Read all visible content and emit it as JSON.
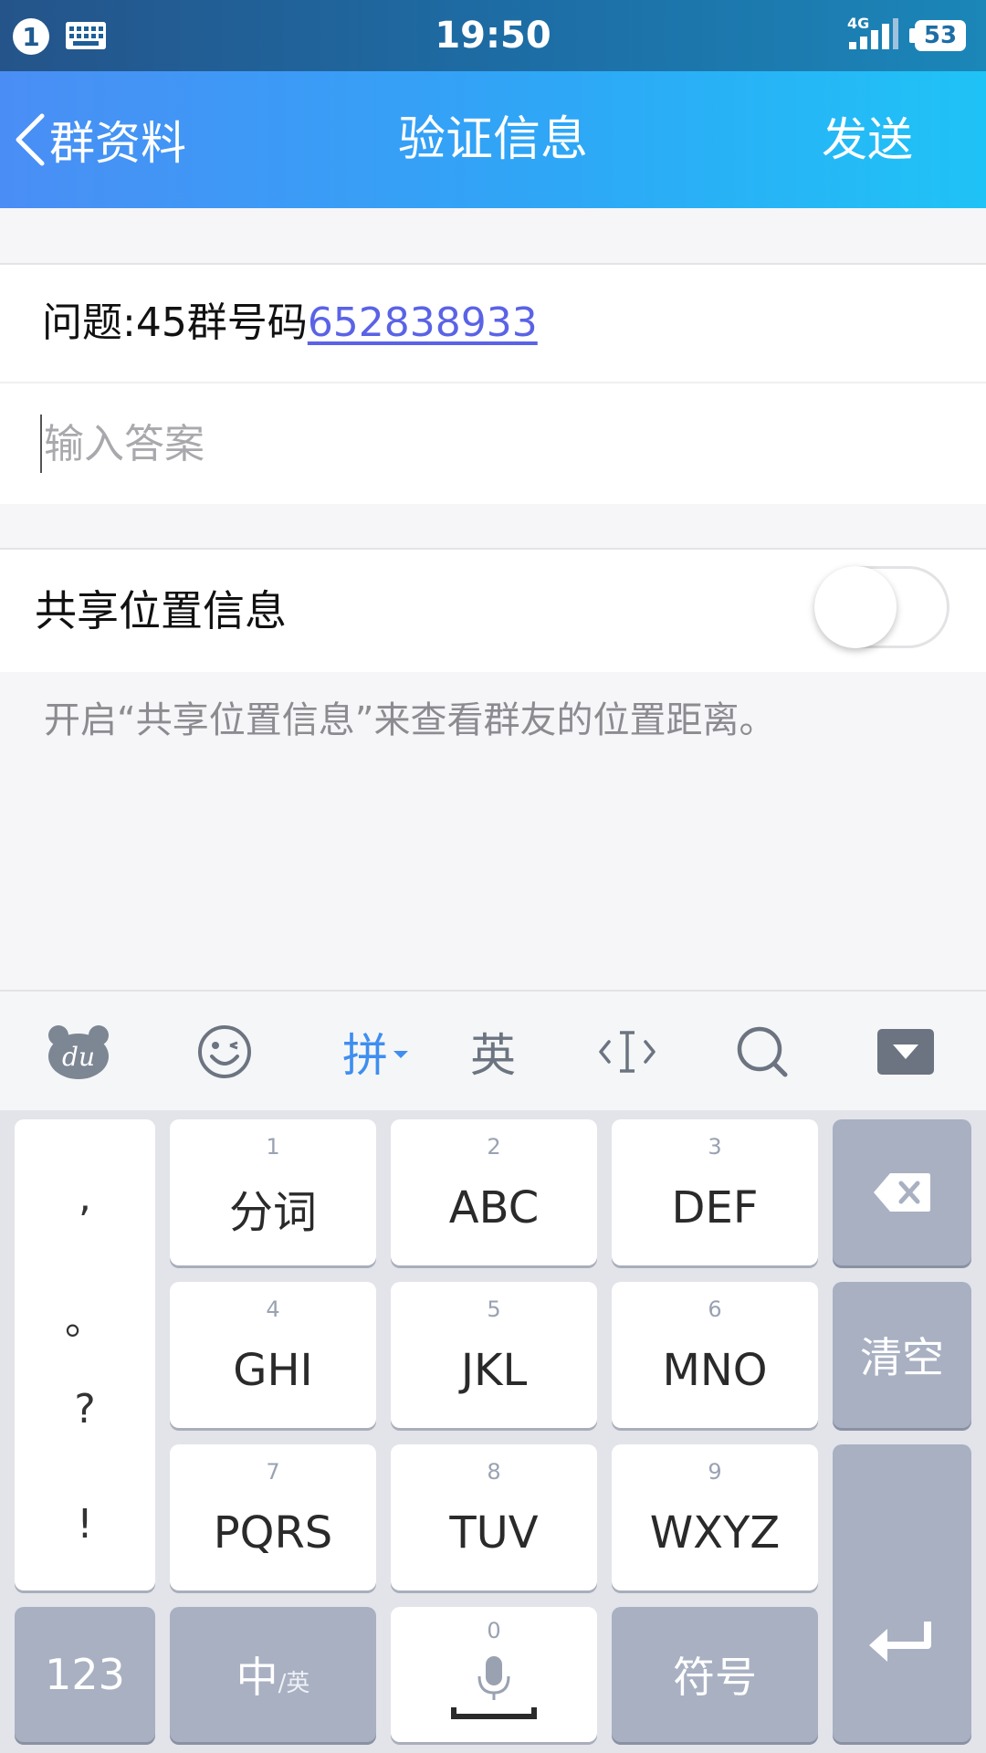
{
  "status_bar": {
    "notification_count": "1",
    "time": "19:50",
    "network": "4G",
    "battery": "53"
  },
  "header": {
    "back_label": "群资料",
    "title": "验证信息",
    "send_label": "发送"
  },
  "form": {
    "question_prefix": "问题:45群号码",
    "question_link": "652838933",
    "answer_placeholder": "输入答案",
    "answer_value": ""
  },
  "location": {
    "label": "共享位置信息",
    "enabled": false,
    "hint": "开启“共享位置信息”来查看群友的位置距离。"
  },
  "keyboard": {
    "toolbar": {
      "pinyin_label": "拼",
      "english_label": "英"
    },
    "punctuation": [
      ",",
      "。",
      "?",
      "!"
    ],
    "keys": [
      {
        "num": "1",
        "label": "分词"
      },
      {
        "num": "2",
        "label": "ABC"
      },
      {
        "num": "3",
        "label": "DEF"
      },
      {
        "num": "4",
        "label": "GHI"
      },
      {
        "num": "5",
        "label": "JKL"
      },
      {
        "num": "6",
        "label": "MNO"
      },
      {
        "num": "7",
        "label": "PQRS"
      },
      {
        "num": "8",
        "label": "TUV"
      },
      {
        "num": "9",
        "label": "WXYZ"
      }
    ],
    "clear_label": "清空",
    "numbers_label": "123",
    "lang_main": "中",
    "lang_sub": "/英",
    "space_num": "0",
    "symbols_label": "符号"
  },
  "colors": {
    "header_gradient_start": "#4a8ef5",
    "header_gradient_end": "#1fc3f6",
    "link": "#5a63e6",
    "keyboard_dark_key": "#a8b0c2",
    "toolbar_active": "#3f8ef0"
  }
}
